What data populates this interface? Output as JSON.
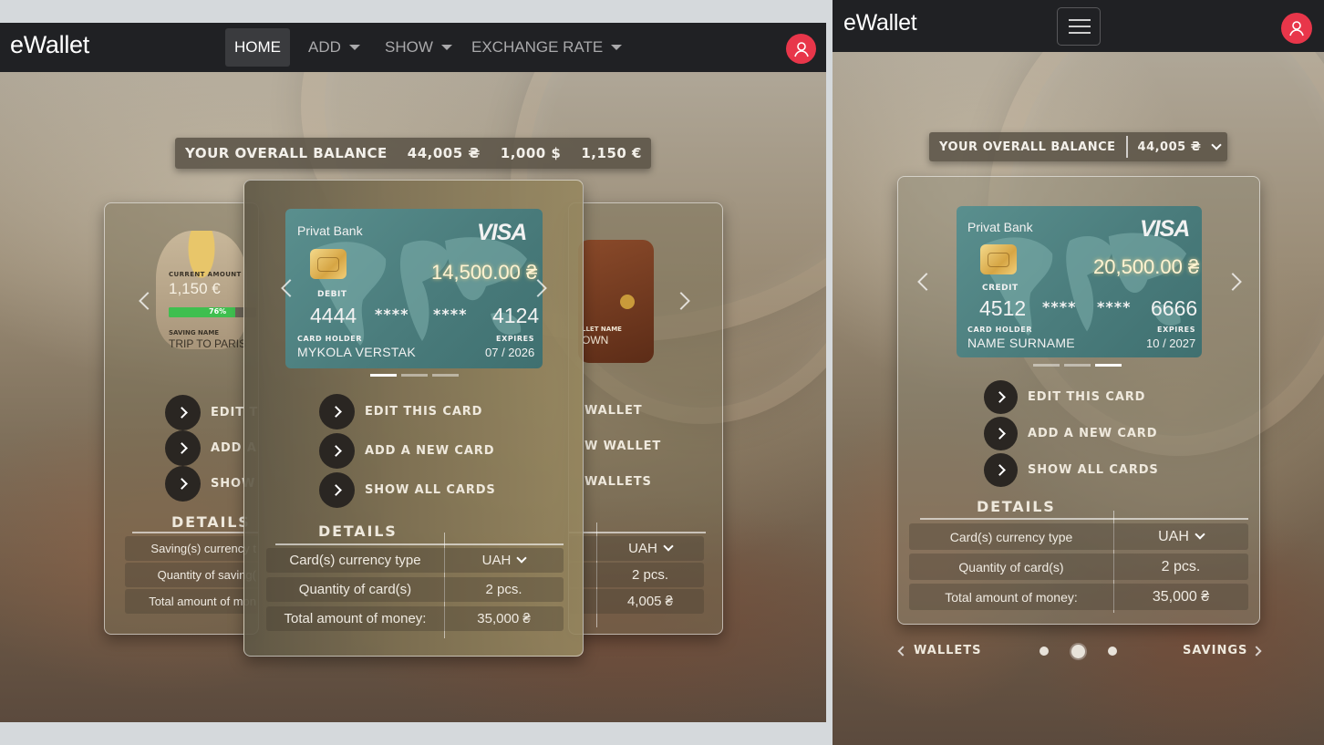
{
  "desktop": {
    "brand": "eWallet",
    "nav": {
      "home": "HOME",
      "add": "ADD",
      "show": "SHOW",
      "exchange": "EXCHANGE RATE"
    },
    "balance": {
      "label": "YOUR OVERALL BALANCE",
      "uah": "44,005 ₴",
      "usd": "1,000 $",
      "eur": "1,150 €"
    },
    "left_panel": {
      "current_amount_label": "CURRENT AMOUNT",
      "current_amount": "1,150 €",
      "progress_label": "76%",
      "progress": 0.76,
      "saving_name_label": "SAVING NAME",
      "saving_name": "TRIP TO PARIS",
      "actions": [
        "EDIT T",
        "ADD A",
        "SHOW"
      ],
      "details_title": "DETAILS",
      "rows": [
        "Saving(s) currency t",
        "Quantity of saving(",
        "Total amount of mon"
      ]
    },
    "right_panel": {
      "wallet_name_label": "LLET NAME",
      "wallet_name": "OWN",
      "actions": [
        "WALLET",
        "W WALLET",
        "WALLETS"
      ],
      "values": [
        "UAH",
        "2 pcs.",
        "4,005 ₴"
      ]
    },
    "center_panel": {
      "card": {
        "bank": "Privat Bank",
        "brand": "VISA",
        "amount": "14,500.00 ₴",
        "type": "DEBIT",
        "first": "4444",
        "mask1": "****",
        "mask2": "****",
        "last": "4124",
        "holder_label": "CARD HOLDER",
        "holder": "MYKOLA VERSTAK",
        "expires_label": "EXPIRES",
        "expires": "07 / 2026"
      },
      "actions": [
        "EDIT THIS CARD",
        "ADD A NEW CARD",
        "SHOW ALL CARDS"
      ],
      "details_title": "DETAILS",
      "rows": [
        {
          "k": "Card(s) currency type",
          "v": "UAH"
        },
        {
          "k": "Quantity of card(s)",
          "v": "2 pcs."
        },
        {
          "k": "Total amount of money:",
          "v": "35,000 ₴"
        }
      ]
    }
  },
  "mobile": {
    "brand": "eWallet",
    "balance": {
      "label": "YOUR OVERALL BALANCE",
      "uah": "44,005 ₴"
    },
    "card": {
      "bank": "Privat Bank",
      "brand": "VISA",
      "amount": "20,500.00 ₴",
      "type": "CREDIT",
      "first": "4512",
      "mask1": "****",
      "mask2": "****",
      "last": "6666",
      "holder_label": "CARD HOLDER",
      "holder": "NAME SURNAME",
      "expires_label": "EXPIRES",
      "expires": "10 / 2027"
    },
    "actions": [
      "EDIT THIS CARD",
      "ADD A NEW CARD",
      "SHOW ALL CARDS"
    ],
    "details_title": "DETAILS",
    "rows": [
      {
        "k": "Card(s) currency type",
        "v": "UAH"
      },
      {
        "k": "Quantity of card(s)",
        "v": "2 pcs."
      },
      {
        "k": "Total amount of money:",
        "v": "35,000 ₴"
      }
    ],
    "prev": "WALLETS",
    "next": "SAVINGS"
  },
  "colors": {
    "navbar": "#202124",
    "avatar": "#e8364a",
    "card": "#4a7c7c",
    "progress": "#3fbf4f"
  }
}
